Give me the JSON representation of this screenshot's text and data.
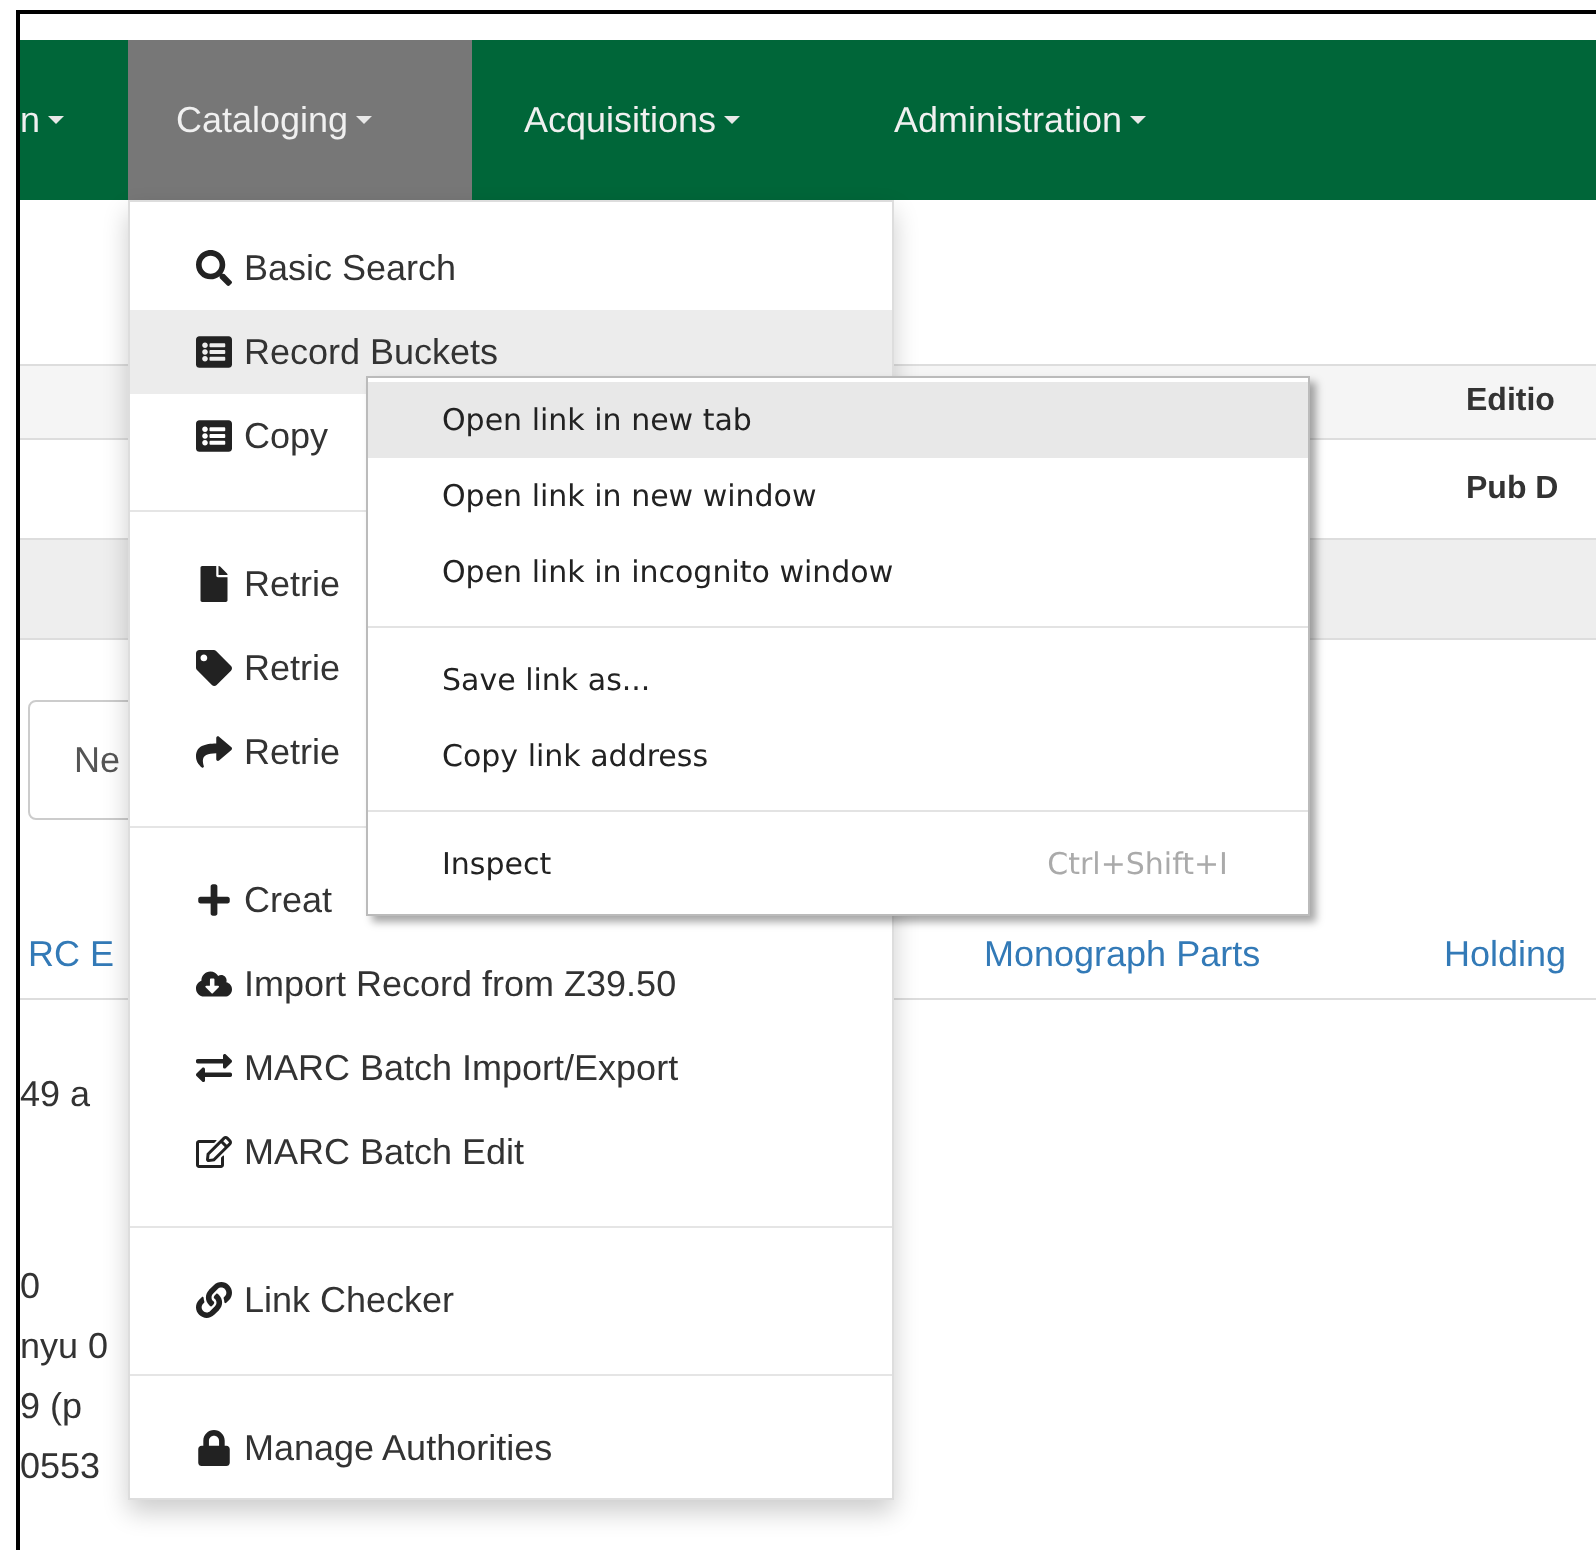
{
  "navbar": {
    "items": [
      {
        "label": "n",
        "selected": false
      },
      {
        "label": "Cataloging",
        "selected": true
      },
      {
        "label": "Acquisitions",
        "selected": false
      },
      {
        "label": "Administration",
        "selected": false
      }
    ]
  },
  "record_summary": {
    "edition_label": "Editio",
    "pub_date_label": "Pub D"
  },
  "new_button": {
    "label": "Ne"
  },
  "record_tabs": [
    {
      "label": "RC E"
    },
    {
      "label": "Monograph Parts"
    },
    {
      "label": "Holding"
    }
  ],
  "record_lines": [
    "49 a",
    "0",
    "nyu 0",
    "9 (p",
    "0553"
  ],
  "cataloging_menu": {
    "items": [
      {
        "kind": "item",
        "label": "Basic Search",
        "highlighted": false
      },
      {
        "kind": "item",
        "label": "Record Buckets",
        "highlighted": true
      },
      {
        "kind": "item",
        "label": "Copy",
        "highlighted": false
      },
      {
        "kind": "divider"
      },
      {
        "kind": "item",
        "label": "Retrie",
        "highlighted": false
      },
      {
        "kind": "item",
        "label": "Retrie",
        "highlighted": false
      },
      {
        "kind": "item",
        "label": "Retrie",
        "highlighted": false
      },
      {
        "kind": "divider"
      },
      {
        "kind": "item",
        "label": "Creat",
        "highlighted": false
      },
      {
        "kind": "item",
        "label": "Import Record from Z39.50",
        "highlighted": false
      },
      {
        "kind": "item",
        "label": "MARC Batch Import/Export",
        "highlighted": false
      },
      {
        "kind": "item",
        "label": "MARC Batch Edit",
        "highlighted": false
      },
      {
        "kind": "divider"
      },
      {
        "kind": "item",
        "label": "Link Checker",
        "highlighted": false
      },
      {
        "kind": "divider"
      },
      {
        "kind": "item",
        "label": "Manage Authorities",
        "highlighted": false
      }
    ]
  },
  "context_menu": {
    "items": [
      {
        "kind": "item",
        "label": "Open link in new tab",
        "highlighted": true
      },
      {
        "kind": "item",
        "label": "Open link in new window",
        "highlighted": false
      },
      {
        "kind": "item",
        "label": "Open link in incognito window",
        "highlighted": false
      },
      {
        "kind": "divider"
      },
      {
        "kind": "item",
        "label": "Save link as...",
        "highlighted": false
      },
      {
        "kind": "item",
        "label": "Copy link address",
        "highlighted": false
      },
      {
        "kind": "divider"
      },
      {
        "kind": "item",
        "label": "Inspect",
        "shortcut": "Ctrl+Shift+I",
        "highlighted": false
      }
    ]
  }
}
